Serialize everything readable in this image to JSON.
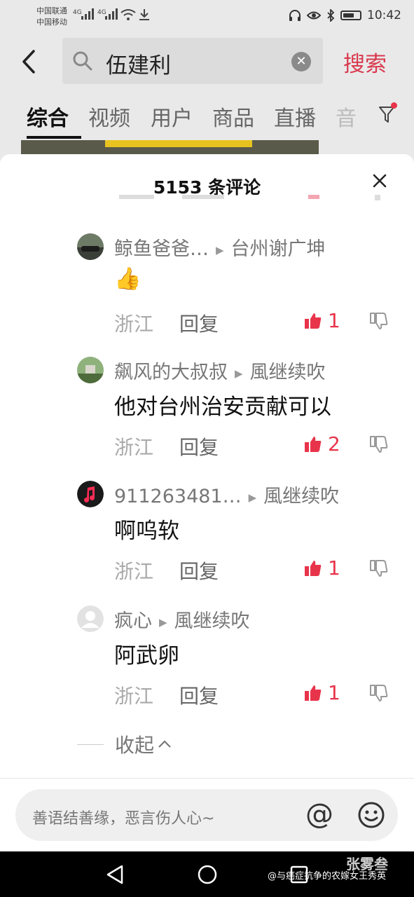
{
  "status_bar": {
    "carrier1": "中国联通",
    "carrier2": "中国移动",
    "net1": "4G",
    "net2": "4G",
    "time": "10:42",
    "battery_level": 0.7
  },
  "search": {
    "query": "伍建利",
    "button_label": "搜索"
  },
  "tabs": [
    {
      "label": "综合",
      "active": true
    },
    {
      "label": "视频"
    },
    {
      "label": "用户"
    },
    {
      "label": "商品"
    },
    {
      "label": "直播"
    },
    {
      "label": "音"
    }
  ],
  "comments_panel": {
    "title": "5153 条评论",
    "comments": [
      {
        "user": "鲸鱼爸爸…",
        "reply_to": "台州谢广坤",
        "text": "👍",
        "location": "浙江",
        "reply_label": "回复",
        "likes": "1"
      },
      {
        "user": "飙风的大叔叔",
        "reply_to": "風继续吹",
        "text": "他对台州治安贡献可以",
        "location": "浙江",
        "reply_label": "回复",
        "likes": "2"
      },
      {
        "user": "911263481…",
        "reply_to": "風继续吹",
        "text": "啊呜软",
        "location": "浙江",
        "reply_label": "回复",
        "likes": "1"
      },
      {
        "user": "疯心",
        "reply_to": "風继续吹",
        "text": "阿武卵",
        "location": "浙江",
        "reply_label": "回复",
        "likes": "1"
      }
    ],
    "collapse_label": "收起",
    "input_placeholder": "善语结善缘，恶言伤人心~",
    "at_symbol": "@"
  },
  "watermark": {
    "text": "@与癌症抗争的农嫁女王秀英",
    "logo_text": "张雾叁"
  },
  "colors": {
    "accent": "#e8344a",
    "search_red": "#d9394e"
  }
}
